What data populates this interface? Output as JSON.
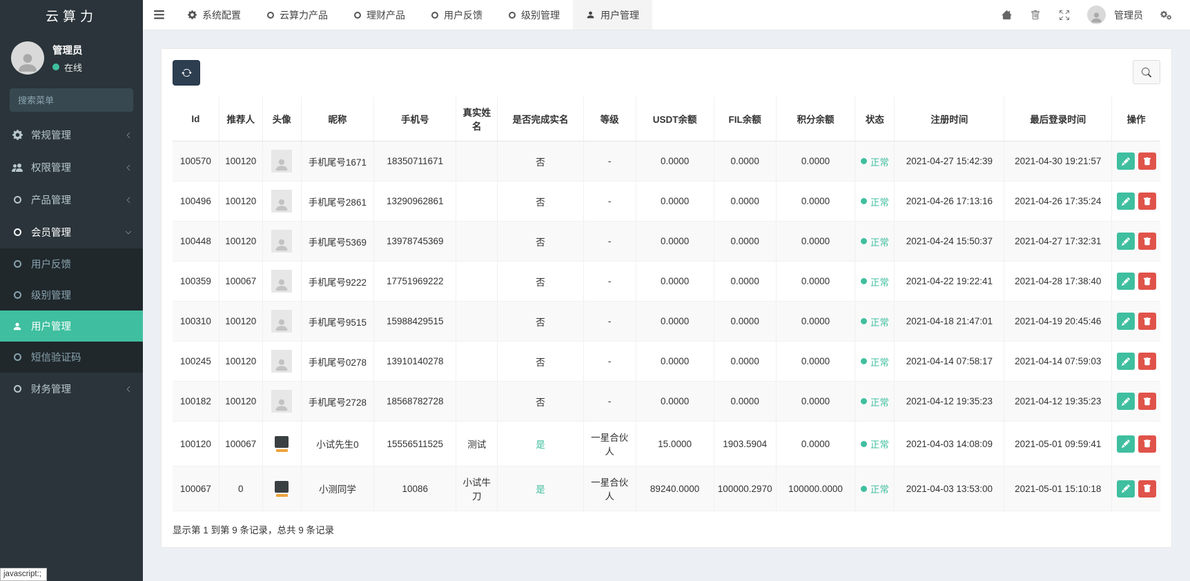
{
  "app": {
    "title": "云算力",
    "status_tooltip": "javascript:;"
  },
  "sidebar": {
    "user": {
      "name": "管理员",
      "status": "在线"
    },
    "search": {
      "placeholder": "搜索菜单"
    },
    "menu": [
      {
        "label": "常规管理"
      },
      {
        "label": "权限管理"
      },
      {
        "label": "产品管理"
      },
      {
        "label": "会员管理"
      },
      {
        "label": "财务管理"
      }
    ],
    "submenu": [
      {
        "label": "用户反馈"
      },
      {
        "label": "级别管理"
      },
      {
        "label": "用户管理"
      },
      {
        "label": "短信验证码"
      }
    ]
  },
  "navbar": {
    "tabs": [
      {
        "label": "系统配置"
      },
      {
        "label": "云算力产品"
      },
      {
        "label": "理财产品"
      },
      {
        "label": "用户反馈"
      },
      {
        "label": "级别管理"
      },
      {
        "label": "用户管理"
      }
    ],
    "user_label": "管理员"
  },
  "table": {
    "columns": [
      "Id",
      "推荐人",
      "头像",
      "昵称",
      "手机号",
      "真实姓名",
      "是否完成实名",
      "等级",
      "USDT余额",
      "FIL余额",
      "积分余额",
      "状态",
      "注册时间",
      "最后登录时间",
      "操作"
    ],
    "rows": [
      {
        "id": "100570",
        "referrer": "100120",
        "avatar": "placeholder",
        "nickname": "手机尾号1671",
        "phone": "18350711671",
        "real_name": "",
        "verified": "否",
        "level": "-",
        "usdt": "0.0000",
        "fil": "0.0000",
        "points": "0.0000",
        "status": "正常",
        "reg_time": "2021-04-27 15:42:39",
        "last_login": "2021-04-30 19:21:57"
      },
      {
        "id": "100496",
        "referrer": "100120",
        "avatar": "placeholder",
        "nickname": "手机尾号2861",
        "phone": "13290962861",
        "real_name": "",
        "verified": "否",
        "level": "-",
        "usdt": "0.0000",
        "fil": "0.0000",
        "points": "0.0000",
        "status": "正常",
        "reg_time": "2021-04-26 17:13:16",
        "last_login": "2021-04-26 17:35:24"
      },
      {
        "id": "100448",
        "referrer": "100120",
        "avatar": "placeholder",
        "nickname": "手机尾号5369",
        "phone": "13978745369",
        "real_name": "",
        "verified": "否",
        "level": "-",
        "usdt": "0.0000",
        "fil": "0.0000",
        "points": "0.0000",
        "status": "正常",
        "reg_time": "2021-04-24 15:50:37",
        "last_login": "2021-04-27 17:32:31"
      },
      {
        "id": "100359",
        "referrer": "100067",
        "avatar": "placeholder",
        "nickname": "手机尾号9222",
        "phone": "17751969222",
        "real_name": "",
        "verified": "否",
        "level": "-",
        "usdt": "0.0000",
        "fil": "0.0000",
        "points": "0.0000",
        "status": "正常",
        "reg_time": "2021-04-22 19:22:41",
        "last_login": "2021-04-28 17:38:40"
      },
      {
        "id": "100310",
        "referrer": "100120",
        "avatar": "placeholder",
        "nickname": "手机尾号9515",
        "phone": "15988429515",
        "real_name": "",
        "verified": "否",
        "level": "-",
        "usdt": "0.0000",
        "fil": "0.0000",
        "points": "0.0000",
        "status": "正常",
        "reg_time": "2021-04-18 21:47:01",
        "last_login": "2021-04-19 20:45:46"
      },
      {
        "id": "100245",
        "referrer": "100120",
        "avatar": "placeholder",
        "nickname": "手机尾号0278",
        "phone": "13910140278",
        "real_name": "",
        "verified": "否",
        "level": "-",
        "usdt": "0.0000",
        "fil": "0.0000",
        "points": "0.0000",
        "status": "正常",
        "reg_time": "2021-04-14 07:58:17",
        "last_login": "2021-04-14 07:59:03"
      },
      {
        "id": "100182",
        "referrer": "100120",
        "avatar": "placeholder",
        "nickname": "手机尾号2728",
        "phone": "18568782728",
        "real_name": "",
        "verified": "否",
        "level": "-",
        "usdt": "0.0000",
        "fil": "0.0000",
        "points": "0.0000",
        "status": "正常",
        "reg_time": "2021-04-12 19:35:23",
        "last_login": "2021-04-12 19:35:23"
      },
      {
        "id": "100120",
        "referrer": "100067",
        "avatar": "photo",
        "nickname": "小试先生0",
        "phone": "15556511525",
        "real_name": "测试",
        "verified": "是",
        "level": "一星合伙人",
        "usdt": "15.0000",
        "fil": "1903.5904",
        "points": "0.0000",
        "status": "正常",
        "reg_time": "2021-04-03 14:08:09",
        "last_login": "2021-05-01 09:59:41"
      },
      {
        "id": "100067",
        "referrer": "0",
        "avatar": "photo",
        "nickname": "小测同学",
        "phone": "10086",
        "real_name": "小试牛刀",
        "verified": "是",
        "level": "一星合伙人",
        "usdt": "89240.0000",
        "fil": "100000.2970",
        "points": "100000.0000",
        "status": "正常",
        "reg_time": "2021-04-03 13:53:00",
        "last_login": "2021-05-01 15:10:18"
      }
    ]
  },
  "footer": {
    "summary": "显示第 1 到第 9 条记录，总共 9 条记录"
  },
  "colors": {
    "accent": "#3fbf9f",
    "danger": "#e0534a",
    "sidebar": "#2a343a",
    "submenu": "#20282c"
  }
}
